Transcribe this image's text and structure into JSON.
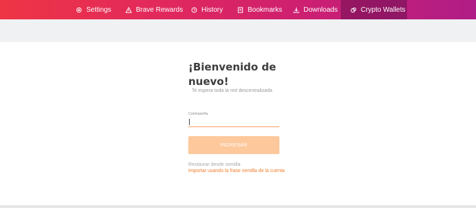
{
  "nav": {
    "tabs": [
      {
        "label": "Settings",
        "icon": "gear-icon",
        "active": false
      },
      {
        "label": "Brave Rewards",
        "icon": "triangle-icon",
        "active": false
      },
      {
        "label": "History",
        "icon": "history-icon",
        "active": false
      },
      {
        "label": "Bookmarks",
        "icon": "bookmark-icon",
        "active": false
      },
      {
        "label": "Downloads",
        "icon": "download-icon",
        "active": false
      },
      {
        "label": "Crypto Wallets",
        "icon": "wallet-icon",
        "active": true
      }
    ]
  },
  "login": {
    "title": "¡Bienvenido de nuevo!",
    "subtitle": "Te espera toda la red descentralizada",
    "password_label": "Contraseña",
    "password_value": "",
    "submit_label": "INGRESAR",
    "restore_link": "Restaurar desde semilla",
    "import_link": "Importar usando la frase semilla de la cuenta"
  },
  "colors": {
    "accent": "#f07b2a",
    "button_bg": "#fdc89c",
    "nav_gradient_start": "#ee3545",
    "nav_gradient_end": "#b01d86"
  }
}
